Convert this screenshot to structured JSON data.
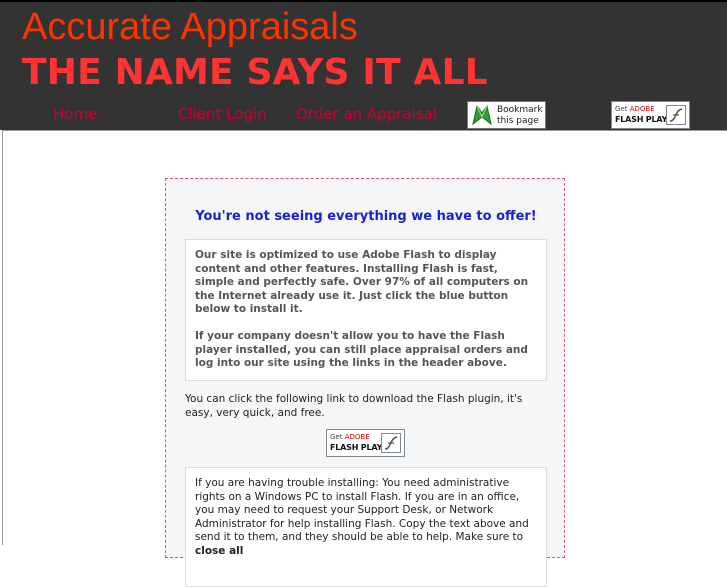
{
  "header": {
    "title": "Accurate Appraisals",
    "tagline": "THE NAME SAYS IT ALL",
    "nav": {
      "home": "Home",
      "client_login": "Client Login",
      "order_appraisal": "Order an Appraisal"
    },
    "bookmark": {
      "line1": "Bookmark",
      "line2": "this page"
    }
  },
  "flash_badge": {
    "get": "Get",
    "adobe": "ADOBE",
    "player": "FLASH PLAYER"
  },
  "notice": {
    "heading": "You're not seeing everything we have to offer!",
    "para1": "Our site is optimized to use Adobe Flash to display content and other features. Installing Flash is fast, simple and perfectly safe. Over 97% of all computers on the Internet already use it. Just click the blue button below to install it.",
    "para2": "If your company doesn't allow you to have the Flash player installed, you can still place appraisal orders and log into our site using the links in the header above.",
    "download_text": "You can click the following link to download the Flash plugin, it's easy, very quick, and free.",
    "trouble_text": "If you are having trouble installing: You need administrative rights on a Windows PC to install Flash. If you are in an office, you may need to request your Support Desk, or Network Administrator for help installing Flash. Copy the text above and send it to them, and they should be able to help. Make sure to",
    "trouble_bold": "close all"
  },
  "colors": {
    "header_bg": "#333333",
    "title": "#ff3300",
    "nav_link": "#cc0033",
    "heading_blue": "#1a22cc"
  }
}
